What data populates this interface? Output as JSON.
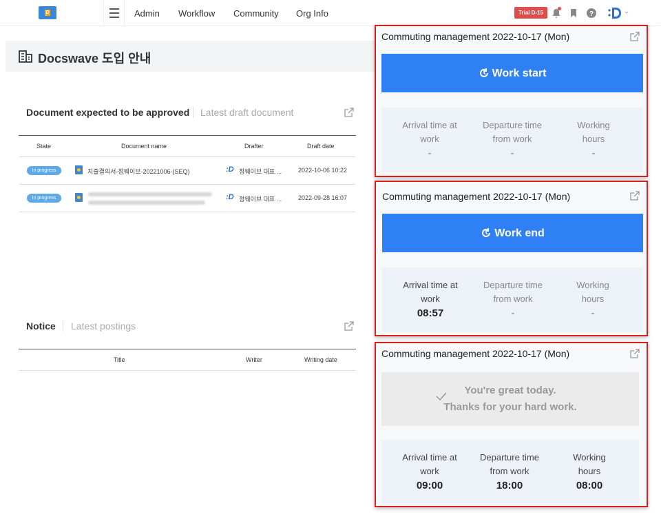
{
  "topbar": {
    "logo_letter": "D",
    "nav": [
      "Admin",
      "Workflow",
      "Community",
      "Org Info"
    ],
    "trial_badge": "Trial D-15",
    "icons": [
      "bell-icon",
      "bookmark-icon",
      "help-icon",
      "brand-icon"
    ]
  },
  "page": {
    "title": "Docswave 도입 안내"
  },
  "approval": {
    "tab_active": "Document expected to be approved",
    "tab_inactive": "Latest draft document",
    "columns": [
      "State",
      "Document name",
      "Drafter",
      "Draft date"
    ],
    "rows": [
      {
        "state": "In progress",
        "doc": "지출결의서-정웨이브-20221006-(SEQ)",
        "drafter": "정웨이브 대표 ...",
        "date": "2022-10-06 10:22"
      },
      {
        "state": "In progress",
        "doc": "",
        "drafter": "정웨이브 대표 ...",
        "date": "2022-09-28 16:07"
      }
    ]
  },
  "notice": {
    "tab_active": "Notice",
    "tab_inactive": "Latest postings",
    "columns": [
      "Title",
      "Writer",
      "Writing date"
    ]
  },
  "cards": [
    {
      "title": "Commuting management 2022-10-17 (Mon)",
      "button": "Work start",
      "arrival_label": "Arrival time at work",
      "departure_label": "Departure time from work",
      "hours_label": "Working hours",
      "arrival": "-",
      "departure": "-",
      "hours": "-"
    },
    {
      "title": "Commuting management 2022-10-17 (Mon)",
      "button": "Work end",
      "arrival_label": "Arrival time at work",
      "departure_label": "Departure time from work",
      "hours_label": "Working hours",
      "arrival": "08:57",
      "departure": "-",
      "hours": "-"
    },
    {
      "title": "Commuting management 2022-10-17 (Mon)",
      "done_line1": "You're great today.",
      "done_line2": "Thanks for your hard work.",
      "arrival_label": "Arrival time at work",
      "departure_label": "Departure time from work",
      "hours_label": "Working hours",
      "arrival": "09:00",
      "departure": "18:00",
      "hours": "08:00"
    }
  ],
  "colors": {
    "accent": "#2f80f5",
    "highlight_border": "#d32020",
    "trial": "#e04c4c"
  }
}
